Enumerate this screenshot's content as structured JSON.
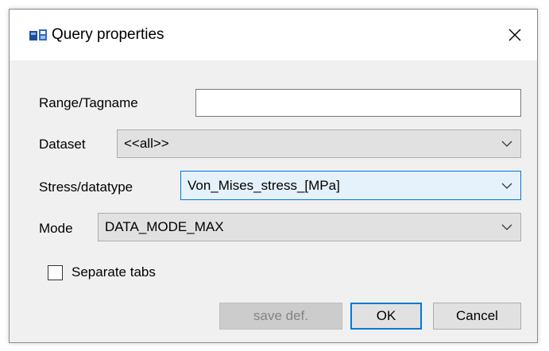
{
  "window": {
    "title": "Query properties",
    "icon": "app-icon",
    "close_glyph": "✕"
  },
  "form": {
    "range_label": "Range/Tagname",
    "range_value": "",
    "dataset_label": "Dataset",
    "dataset_value": "<<all>>",
    "stress_label": "Stress/datatype",
    "stress_value": "Von_Mises_stress_[MPa]",
    "mode_label": "Mode",
    "mode_value": "DATA_MODE_MAX",
    "separate_tabs_label": "Separate tabs",
    "separate_tabs_checked": false
  },
  "buttons": {
    "save_def": "save def.",
    "ok": "OK",
    "cancel": "Cancel"
  },
  "colors": {
    "focus_accent": "#0078d7",
    "dialog_bg": "#f0f0f0"
  }
}
